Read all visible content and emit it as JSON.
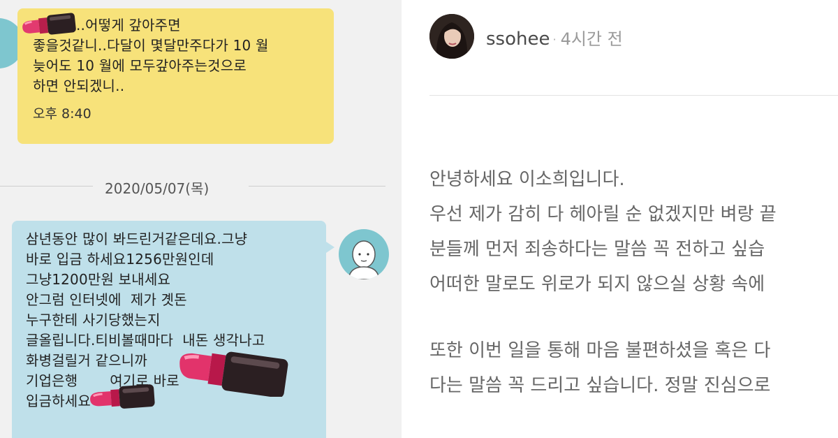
{
  "chat": {
    "yellow_message": {
      "lines": [
        "..어떻게 갚아주면",
        "좋을것같니..다달이 몇달만주다가 10 월",
        "늦어도 10 월에 모두갚아주는것으로",
        "하면 안되겠니.."
      ],
      "time": "오후 8:40"
    },
    "date_separator": "2020/05/07(목)",
    "blue_message": {
      "lines": [
        "삼년동안 많이 봐드린거같은데요.그냥",
        "바로 입금 하세요1256만원인데",
        "그냥1200만원 보내세요",
        "안그럼 인터넷에  제가 곗돈",
        "누구한테 사기당했는지",
        "글올립니다.티비볼때마다  내돈 생각나고",
        "화병걸릴거 같으니까",
        "기업은행       여기로 바로",
        "입금하세요"
      ]
    },
    "colors": {
      "yellow_bubble": "#f7e27a",
      "blue_bubble": "#bfe0ea",
      "avatar": "#7ec6cf",
      "background": "#f1f1f1"
    },
    "icons": [
      "lipstick-icon",
      "default-avatar-icon"
    ]
  },
  "post": {
    "username": "ssohee",
    "time_ago": "4시간 전",
    "paragraph1": [
      "안녕하세요 이소희입니다.",
      "우선 제가 감히 다 헤아릴 순 없겠지만 벼랑 끝",
      "분들께 먼저 죄송하다는 말씀 꼭 전하고 싶습",
      "어떠한 말로도 위로가 되지 않으실 상황 속에"
    ],
    "paragraph2": [
      "또한 이번 일을 통해 마음 불편하셨을 혹은 다",
      "다는 말씀 꼭 드리고 싶습니다. 정말 진심으로"
    ]
  }
}
